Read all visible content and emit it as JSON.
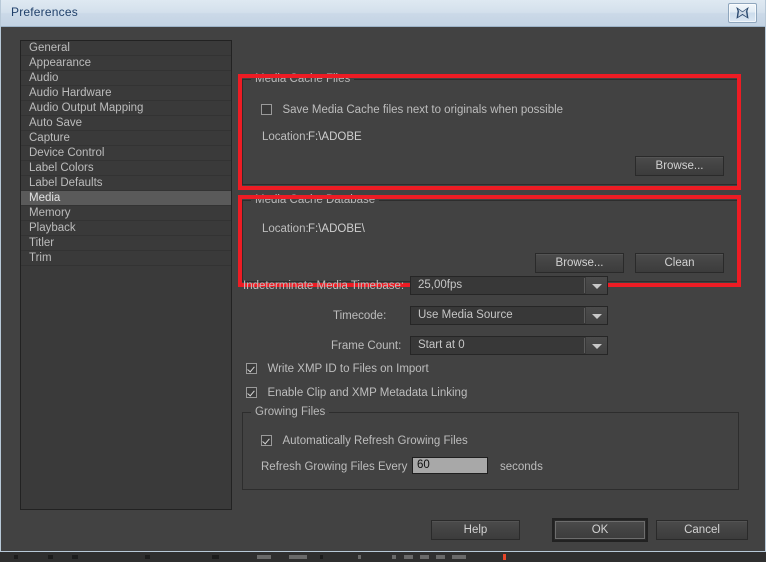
{
  "window": {
    "title": "Preferences",
    "close_icon": "close-icon"
  },
  "sidebar": {
    "items": [
      {
        "label": "General",
        "selected": false
      },
      {
        "label": "Appearance",
        "selected": false
      },
      {
        "label": "Audio",
        "selected": false
      },
      {
        "label": "Audio Hardware",
        "selected": false
      },
      {
        "label": "Audio Output Mapping",
        "selected": false
      },
      {
        "label": "Auto Save",
        "selected": false
      },
      {
        "label": "Capture",
        "selected": false
      },
      {
        "label": "Device Control",
        "selected": false
      },
      {
        "label": "Label Colors",
        "selected": false
      },
      {
        "label": "Label Defaults",
        "selected": false
      },
      {
        "label": "Media",
        "selected": true
      },
      {
        "label": "Memory",
        "selected": false
      },
      {
        "label": "Playback",
        "selected": false
      },
      {
        "label": "Titler",
        "selected": false
      },
      {
        "label": "Trim",
        "selected": false
      }
    ]
  },
  "media_cache_files": {
    "group_title": "Media Cache Files",
    "save_next_to_originals": {
      "label": "Save Media Cache files next to originals when possible",
      "checked": false
    },
    "location_label": "Location:",
    "location_value": "F:\\ADOBE",
    "browse_label": "Browse..."
  },
  "media_cache_database": {
    "group_title": "Media Cache Database",
    "location_label": "Location:",
    "location_value": "F:\\ADOBE\\",
    "browse_label": "Browse...",
    "clean_label": "Clean"
  },
  "settings": {
    "timebase": {
      "label": "Indeterminate Media Timebase:",
      "value": "25,00fps"
    },
    "timecode": {
      "label": "Timecode:",
      "value": "Use Media Source"
    },
    "frame_count": {
      "label": "Frame Count:",
      "value": "Start at 0"
    }
  },
  "checkboxes": [
    {
      "label": "Write XMP ID to Files on Import",
      "checked": true
    },
    {
      "label": "Enable Clip and XMP Metadata Linking",
      "checked": true
    }
  ],
  "growing_files": {
    "group_title": "Growing Files",
    "auto_refresh": {
      "label": "Automatically Refresh Growing Files",
      "checked": true
    },
    "refresh_label": "Refresh Growing Files Every",
    "refresh_value": "60",
    "seconds_label": "seconds"
  },
  "footer": {
    "help_label": "Help",
    "ok_label": "OK",
    "cancel_label": "Cancel"
  },
  "annotations": {
    "accent_color": "#ed1c24",
    "count": 2
  }
}
